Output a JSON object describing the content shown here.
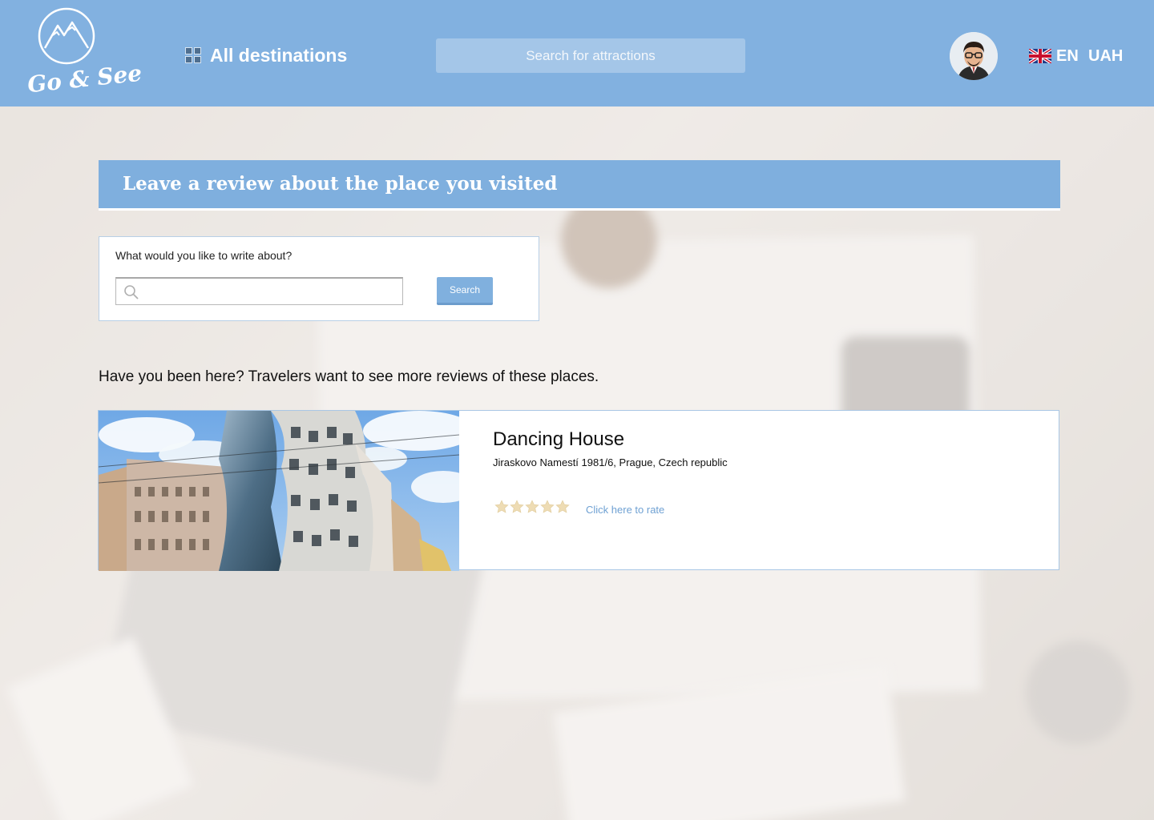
{
  "header": {
    "logo_text": "Go & See",
    "all_destinations_label": "All destinations",
    "search_placeholder": "Search for attractions",
    "language": "EN",
    "currency": "UAH"
  },
  "review": {
    "banner_title": "Leave a review about the place you visited",
    "search_label": "What would you like to write about?",
    "search_value": "",
    "search_button_label": "Search"
  },
  "prompt_text": "Have you been here? Travelers want to see more reviews of these places.",
  "place": {
    "name": "Dancing House",
    "address": "Jiraskovo Namestí 1981/6, Prague, Czech republic",
    "rating": 0,
    "max_rating": 5,
    "rate_link_label": "Click here to rate"
  },
  "colors": {
    "header_bg": "#82b1e0",
    "banner_bg": "#7fafde",
    "button_bg": "#80b0de",
    "link": "#6fa1d3",
    "star_empty": "#eedcb4"
  },
  "icons": {
    "logo": "mountain-logo-icon",
    "destinations": "grid-icon",
    "search": "magnifier-icon",
    "flag": "uk-flag-icon",
    "star": "star-icon"
  }
}
